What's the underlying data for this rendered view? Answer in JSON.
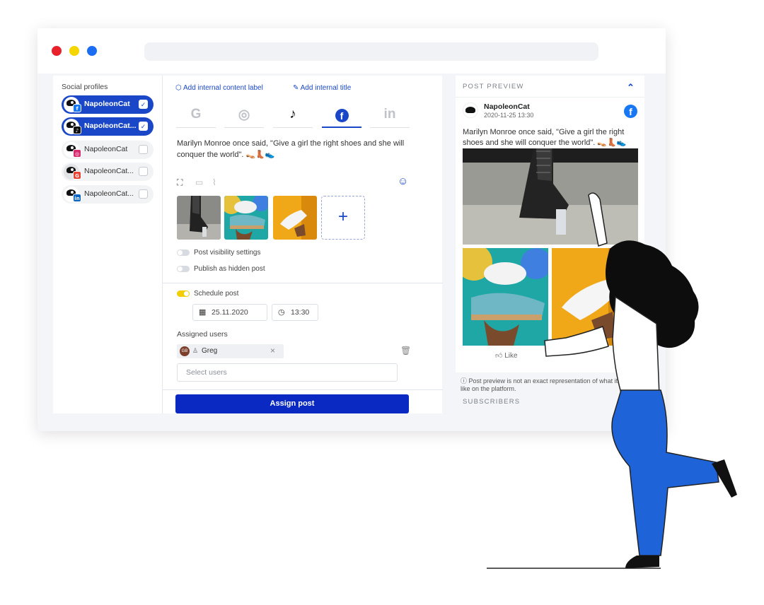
{
  "colors": {
    "accent": "#1a47c8",
    "button": "#0a28c2",
    "toggle_on": "#f2cd00",
    "dot_red": "#e8212a",
    "dot_yellow": "#f6d600",
    "dot_blue": "#1b6ef3"
  },
  "sidebar": {
    "title": "Social profiles",
    "profiles": [
      {
        "name": "NapoleonCat",
        "network": "facebook",
        "badge": "f",
        "selected": true
      },
      {
        "name": "NapoleonCat...",
        "network": "tiktok",
        "badge": "♪",
        "selected": true
      },
      {
        "name": "NapoleonCat",
        "network": "instagram",
        "badge": "◎",
        "selected": false
      },
      {
        "name": "NapoleonCat...",
        "network": "google",
        "badge": "G",
        "selected": false
      },
      {
        "name": "NapoleonCat...",
        "network": "linkedin",
        "badge": "in",
        "selected": false
      }
    ],
    "check_mark": "✓"
  },
  "editor": {
    "add_label": "Add internal content label",
    "add_title": "Add internal title",
    "tabs": [
      {
        "icon": "google-icon",
        "glyph": "G"
      },
      {
        "icon": "instagram-icon",
        "glyph": "◎"
      },
      {
        "icon": "tiktok-icon",
        "glyph": "♪"
      },
      {
        "icon": "facebook-icon",
        "glyph": "f"
      },
      {
        "icon": "linkedin-icon",
        "glyph": "in"
      }
    ],
    "active_tab": "facebook",
    "post_text": "Marilyn Monroe once said, \"Give a girl the right shoes and she will conquer the world\". 👡👢👟",
    "add_media": "+",
    "toggles": [
      {
        "label": "Post visibility settings",
        "on": false
      },
      {
        "label": "Publish as hidden post",
        "on": false
      }
    ],
    "schedule": {
      "label": "Schedule post",
      "on": true,
      "date": "25.11.2020",
      "time": "13:30"
    },
    "assigned_users_label": "Assigned users",
    "user_chip": {
      "initials": "GB",
      "name": "Greg",
      "remove": "×"
    },
    "select_placeholder": "Select users",
    "assign_button": "Assign post"
  },
  "preview": {
    "title": "POST PREVIEW",
    "collapse": "⌃",
    "account": "NapoleonCat",
    "timestamp": "2020-11-25 13:30",
    "text": "Marilyn Monroe once said, \"Give a girl the right shoes and she will conquer the world\". 👡👢👟",
    "like": "Like",
    "disclaimer": "ⓘ Post preview is not an exact representation of what it looks like on the platform.",
    "subscribers": "SUBSCRIBERS"
  }
}
